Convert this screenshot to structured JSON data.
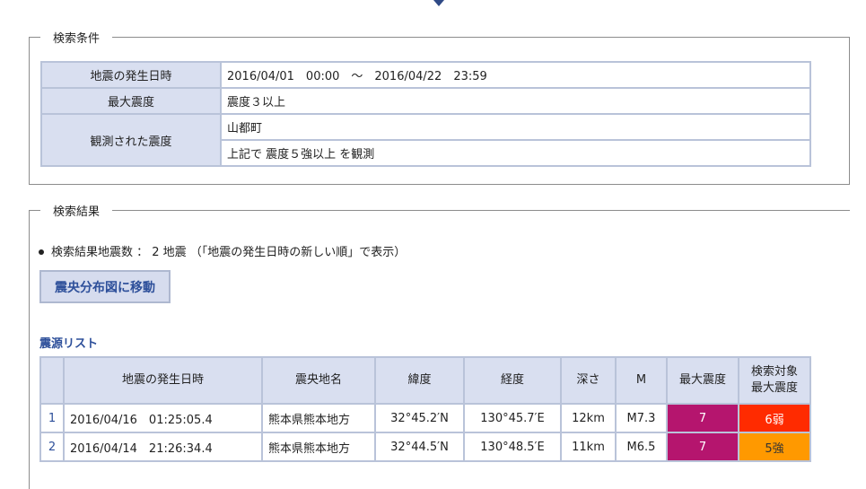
{
  "conditions": {
    "legend": "検索条件",
    "rows": [
      {
        "label": "地震の発生日時",
        "value": "2016/04/01　00:00　～　2016/04/22　23:59"
      },
      {
        "label": "最大震度",
        "value": "震度３以上"
      },
      {
        "label": "観測された震度",
        "values": [
          "山都町",
          "上記で 震度５強以上 を観測"
        ]
      }
    ]
  },
  "results": {
    "legend": "検索結果",
    "summary": "検索結果地震数 ： 2 地震 （「地震の発生日時の新しい順」で表示）",
    "map_button": "震央分布図に移動",
    "list_title": "震源リスト",
    "columns": [
      "",
      "地震の発生日時",
      "震央地名",
      "緯度",
      "経度",
      "深さ",
      "M",
      "最大震度",
      "検索対象最大震度"
    ],
    "search_intensity_header": [
      "検索対象",
      "最大震度"
    ],
    "rows": [
      {
        "no": "1",
        "datetime": "2016/04/16　01:25:05.4",
        "place": "熊本県熊本地方",
        "lat": "32°45.2′N",
        "lon": "130°45.7′E",
        "depth": "12km",
        "mag": "M7.3",
        "max": "7",
        "max_color": "#b5156e",
        "target": "6弱",
        "target_color": "#ff2b00",
        "target_text_color": "#ffffff"
      },
      {
        "no": "2",
        "datetime": "2016/04/14　21:26:34.4",
        "place": "熊本県熊本地方",
        "lat": "32°44.5′N",
        "lon": "130°48.5′E",
        "depth": "11km",
        "mag": "M6.5",
        "max": "7",
        "max_color": "#b5156e",
        "target": "5強",
        "target_color": "#ff9900",
        "target_text_color": "#333333"
      }
    ]
  }
}
